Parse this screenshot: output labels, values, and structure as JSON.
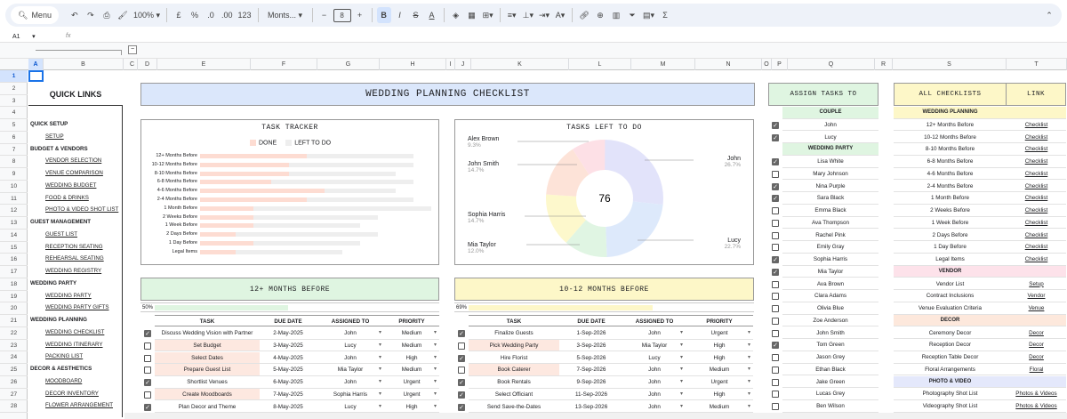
{
  "toolbar": {
    "menu": "Menu",
    "zoom": "100%",
    "currency": "£",
    "percent": "%",
    "dec_less": ".0",
    "dec_more": ".00",
    "format123": "123",
    "font": "Monts...",
    "font_size": "8"
  },
  "formula_bar": {
    "cell_ref": "A1",
    "fx": "fx"
  },
  "columns": [
    "A",
    "B",
    "C",
    "D",
    "E",
    "F",
    "G",
    "H",
    "I",
    "J",
    "K",
    "L",
    "M",
    "N",
    "O",
    "P",
    "Q",
    "R",
    "S",
    "T"
  ],
  "rows": [
    "1",
    "2",
    "3",
    "4",
    "5",
    "6",
    "7",
    "8",
    "9",
    "10",
    "11",
    "12",
    "13",
    "14",
    "15",
    "16",
    "17",
    "18",
    "19",
    "20",
    "21",
    "22",
    "23",
    "24",
    "25",
    "26",
    "27",
    "28"
  ],
  "quick_links": {
    "title": "QUICK LINKS",
    "items": [
      {
        "label": "QUICK SETUP",
        "type": "hdr"
      },
      {
        "label": "SETUP",
        "type": "lnk"
      },
      {
        "label": "BUDGET & VENDORS",
        "type": "hdr"
      },
      {
        "label": "VENDOR SELECTION",
        "type": "lnk"
      },
      {
        "label": "VENUE COMPARISON",
        "type": "lnk"
      },
      {
        "label": "WEDDING BUDGET",
        "type": "lnk"
      },
      {
        "label": "FOOD & DRINKS",
        "type": "lnk"
      },
      {
        "label": "PHOTO & VIDEO SHOT LIST",
        "type": "lnk"
      },
      {
        "label": "GUEST MANAGEMENT",
        "type": "hdr"
      },
      {
        "label": "GUEST LIST",
        "type": "lnk"
      },
      {
        "label": "RECEPTION SEATING",
        "type": "lnk"
      },
      {
        "label": "REHEARSAL SEATING",
        "type": "lnk"
      },
      {
        "label": "WEDDING REGISTRY",
        "type": "lnk"
      },
      {
        "label": "WEDDING PARTY",
        "type": "hdr"
      },
      {
        "label": "WEDDING PARTY",
        "type": "lnk"
      },
      {
        "label": "WEDDING PARTY GIFTS",
        "type": "lnk"
      },
      {
        "label": "WEDDING PLANNING",
        "type": "hdr"
      },
      {
        "label": "WEDDING CHECKLIST",
        "type": "lnk"
      },
      {
        "label": "WEDDING ITINERARY",
        "type": "lnk"
      },
      {
        "label": "PACKING LIST",
        "type": "lnk"
      },
      {
        "label": "DECOR & AESTHETICS",
        "type": "hdr"
      },
      {
        "label": "MOODBOARD",
        "type": "lnk"
      },
      {
        "label": "DECOR INVENTORY",
        "type": "lnk"
      },
      {
        "label": "FLOWER ARRANGEMENT",
        "type": "lnk"
      }
    ]
  },
  "main_title": "WEDDING PLANNING CHECKLIST",
  "colors": {
    "done": "#fddcd2",
    "left": "#eeeeee",
    "header_blue": "#dbe7fb",
    "header_green": "#dff5e1",
    "header_yellow": "#fdf7c8",
    "highlight": "#fde8e0"
  },
  "chart_data": [
    {
      "type": "bar",
      "title": "TASK TRACKER",
      "legend": [
        "DONE",
        "LEFT TO DO"
      ],
      "categories": [
        "12+ Months Before",
        "10-12 Months Before",
        "8-10 Months Before",
        "6-8 Months Before",
        "4-6 Months Before",
        "2-4 Months Before",
        "1 Month Before",
        "2 Weeks Before",
        "1 Week Before",
        "2 Days Before",
        "1 Day Before",
        "Legal Items"
      ],
      "series": [
        {
          "name": "DONE",
          "values": [
            6,
            5,
            5,
            4,
            7,
            6,
            3,
            3,
            3,
            2,
            3,
            2
          ]
        },
        {
          "name": "LEFT TO DO",
          "values": [
            6,
            7,
            6,
            8,
            4,
            6,
            10,
            7,
            6,
            8,
            6,
            6
          ]
        }
      ]
    },
    {
      "type": "pie",
      "title": "TASKS LEFT TO DO",
      "center_label": "76",
      "slices": [
        {
          "name": "John",
          "pct": "26.7%",
          "value": 26.7,
          "color": "#e2e3fa"
        },
        {
          "name": "Lucy",
          "pct": "22.7%",
          "value": 22.7,
          "color": "#dde9fb"
        },
        {
          "name": "Mia Taylor",
          "pct": "12.0%",
          "value": 12.0,
          "color": "#e0f5e3"
        },
        {
          "name": "Sophia Harris",
          "pct": "14.7%",
          "value": 14.7,
          "color": "#fdf8cc"
        },
        {
          "name": "John Smith",
          "pct": "14.7%",
          "value": 14.7,
          "color": "#fde3d8"
        },
        {
          "name": "Alex Brown",
          "pct": "9.3%",
          "value": 9.3,
          "color": "#fde0e6"
        }
      ]
    }
  ],
  "sections": [
    {
      "title": "12+ MONTHS BEFORE",
      "progress": "50%",
      "progress_value": 0.5,
      "headers": [
        "TASK",
        "DUE DATE",
        "ASSIGNED TO",
        "PRIORITY"
      ],
      "rows": [
        {
          "done": true,
          "task": "Discuss Wedding Vision with Partner",
          "due": "2-May-2025",
          "who": "John",
          "prio": "Medium"
        },
        {
          "done": false,
          "task": "Set Budget",
          "due": "3-May-2025",
          "who": "Lucy",
          "prio": "Medium"
        },
        {
          "done": false,
          "task": "Select Dates",
          "due": "4-May-2025",
          "who": "John",
          "prio": "High"
        },
        {
          "done": false,
          "task": "Prepare Guest List",
          "due": "5-May-2025",
          "who": "Mia Taylor",
          "prio": "Medium"
        },
        {
          "done": true,
          "task": "Shortlist Venues",
          "due": "6-May-2025",
          "who": "John",
          "prio": "Urgent"
        },
        {
          "done": false,
          "task": "Create Moodboards",
          "due": "7-May-2025",
          "who": "Sophia Harris",
          "prio": "Urgent"
        },
        {
          "done": true,
          "task": "Plan Decor and Theme",
          "due": "8-May-2025",
          "who": "Lucy",
          "prio": "High"
        }
      ]
    },
    {
      "title": "10-12 MONTHS BEFORE",
      "progress": "69%",
      "progress_value": 0.69,
      "headers": [
        "TASK",
        "DUE DATE",
        "ASSIGNED TO",
        "PRIORITY"
      ],
      "rows": [
        {
          "done": true,
          "task": "Finalize Guests",
          "due": "1-Sep-2026",
          "who": "John",
          "prio": "Urgent"
        },
        {
          "done": false,
          "task": "Pick Wedding Party",
          "due": "3-Sep-2026",
          "who": "Mia Taylor",
          "prio": "High"
        },
        {
          "done": true,
          "task": "Hire Florist",
          "due": "5-Sep-2026",
          "who": "Lucy",
          "prio": "High"
        },
        {
          "done": false,
          "task": "Book Caterer",
          "due": "7-Sep-2026",
          "who": "John",
          "prio": "Medium"
        },
        {
          "done": true,
          "task": "Book Rentals",
          "due": "9-Sep-2026",
          "who": "John",
          "prio": "Urgent"
        },
        {
          "done": true,
          "task": "Select Officiant",
          "due": "11-Sep-2026",
          "who": "John",
          "prio": "High"
        },
        {
          "done": true,
          "task": "Send Save-the-Dates",
          "due": "13-Sep-2026",
          "who": "John",
          "prio": "Medium"
        }
      ]
    }
  ],
  "assign": {
    "title": "ASSIGN TASKS TO",
    "rows": [
      {
        "label": "COUPLE",
        "sub": true
      },
      {
        "label": "John",
        "check": true
      },
      {
        "label": "Lucy",
        "check": true
      },
      {
        "label": "WEDDING PARTY",
        "sub": true
      },
      {
        "label": "Lisa White",
        "check": true
      },
      {
        "label": "Mary Johnson",
        "check": false
      },
      {
        "label": "Nina Purple",
        "check": true
      },
      {
        "label": "Sara Black",
        "check": true
      },
      {
        "label": "Emma Black",
        "check": false
      },
      {
        "label": "Ava Thompson",
        "check": false
      },
      {
        "label": "Rachel Pink",
        "check": false
      },
      {
        "label": "Emily Gray",
        "check": false
      },
      {
        "label": "Sophia Harris",
        "check": true
      },
      {
        "label": "Mia Taylor",
        "check": true
      },
      {
        "label": "Ava Brown",
        "check": false
      },
      {
        "label": "Clara Adams",
        "check": false
      },
      {
        "label": "Olivia Blue",
        "check": false
      },
      {
        "label": "Zoe Anderson",
        "check": false
      },
      {
        "label": "John Smith",
        "check": false
      },
      {
        "label": "Tom Green",
        "check": true
      },
      {
        "label": "Jason Grey",
        "check": false
      },
      {
        "label": "Ethan Black",
        "check": false
      },
      {
        "label": "Jake Green",
        "check": false
      },
      {
        "label": "Lucas Grey",
        "check": false
      },
      {
        "label": "Ben Wilson",
        "check": false
      }
    ]
  },
  "checklists": {
    "title": "ALL CHECKLISTS",
    "link_title": "LINK",
    "rows": [
      {
        "label": "WEDDING PLANNING",
        "sub": true,
        "color": "#fdf7c8",
        "link": ""
      },
      {
        "label": "12+ Months Before",
        "link": "Checklist"
      },
      {
        "label": "10-12 Months Before",
        "link": "Checklist"
      },
      {
        "label": "8-10 Months Before",
        "link": "Checklist"
      },
      {
        "label": "6-8 Months Before",
        "link": "Checklist"
      },
      {
        "label": "4-6 Months Before",
        "link": "Checklist"
      },
      {
        "label": "2-4 Months Before",
        "link": "Checklist"
      },
      {
        "label": "1 Month Before",
        "link": "Checklist"
      },
      {
        "label": "2 Weeks Before",
        "link": "Checklist"
      },
      {
        "label": "1 Week Before",
        "link": "Checklist"
      },
      {
        "label": "2 Days Before",
        "link": "Checklist"
      },
      {
        "label": "1 Day Before",
        "link": "Checklist"
      },
      {
        "label": "Legal Items",
        "link": "Checklist"
      },
      {
        "label": "VENDOR",
        "sub": true,
        "color": "#fde2ea",
        "link": ""
      },
      {
        "label": "Vendor List",
        "link": "Setup"
      },
      {
        "label": "Contract Inclusions",
        "link": "Vendor"
      },
      {
        "label": "Venue Evaluation Criteria",
        "link": "Venue"
      },
      {
        "label": "DECOR",
        "sub": true,
        "color": "#fde8dc",
        "link": ""
      },
      {
        "label": "Ceremony Decor",
        "link": "Decor"
      },
      {
        "label": "Reception Decor",
        "link": "Decor"
      },
      {
        "label": "Reception Table Decor",
        "link": "Decor"
      },
      {
        "label": "Floral Arrangements",
        "link": "Floral"
      },
      {
        "label": "PHOTO & VIDEO",
        "sub": true,
        "color": "#e4e8fb",
        "link": ""
      },
      {
        "label": "Photography Shot List",
        "link": "Photos & Videos"
      },
      {
        "label": "Videography Shot List",
        "link": "Photos & Videos"
      }
    ]
  }
}
